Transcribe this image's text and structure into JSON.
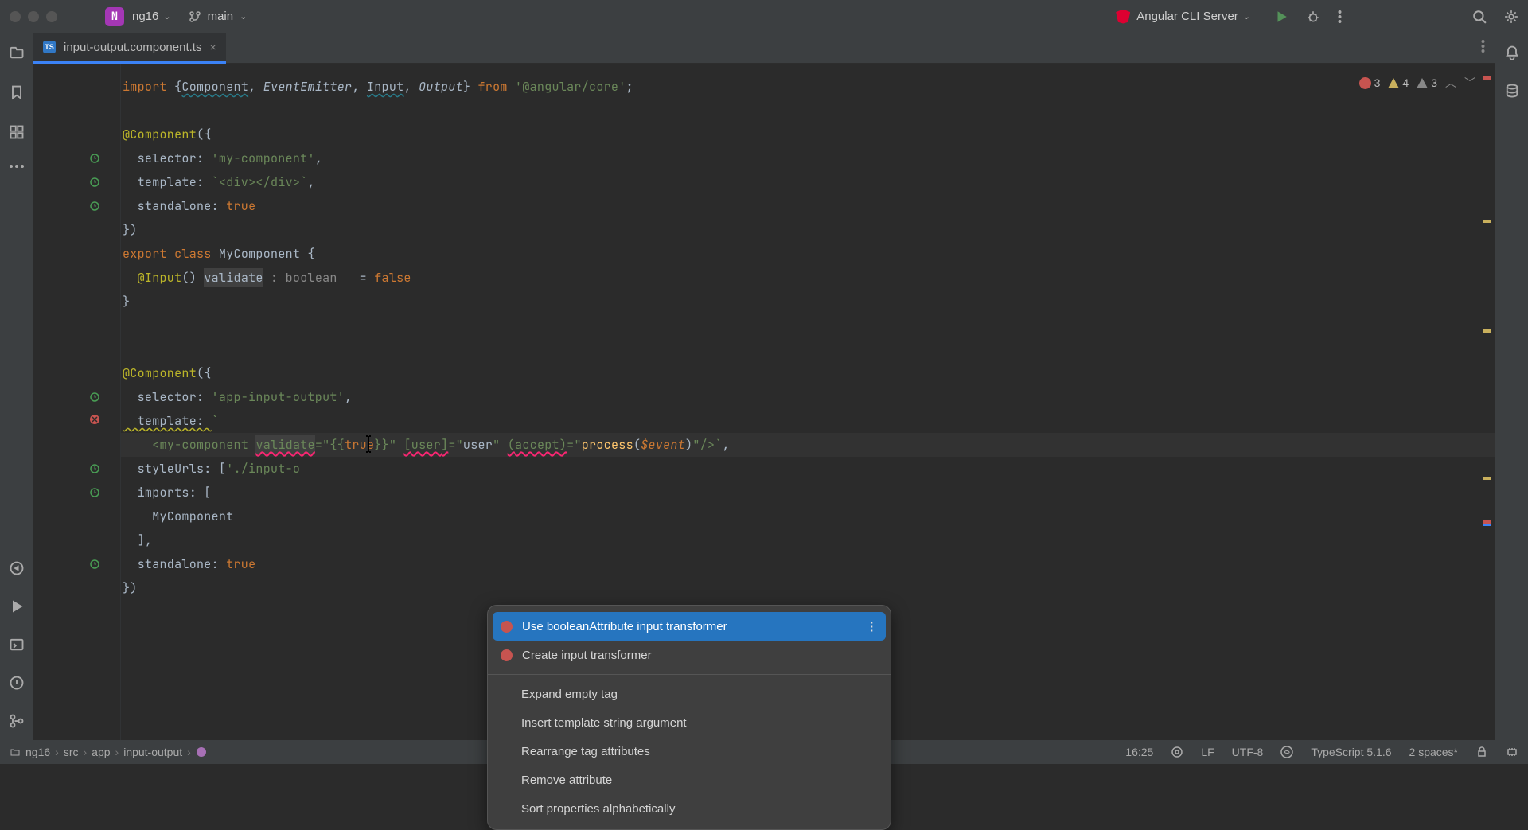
{
  "topbar": {
    "project_name": "ng16",
    "branch": "main",
    "server": "Angular CLI Server"
  },
  "tab": {
    "filename": "input-output.component.ts",
    "file_type": "TS"
  },
  "inspection": {
    "errors": "3",
    "warnings": "4",
    "weak": "3"
  },
  "code": {
    "l1_import": "import",
    "l1_braceopen": " {",
    "l1_component": "Component",
    "l1_c1": ", ",
    "l1_eventemitter": "EventEmitter",
    "l1_c2": ", ",
    "l1_input": "Input",
    "l1_c3": ", ",
    "l1_output": "Output",
    "l1_braceclose": "} ",
    "l1_from": "from ",
    "l1_path": "'@angular/core'",
    "l1_semi": ";",
    "l3_dec": "@Component",
    "l3_rest": "({",
    "l4_key": "  selector: ",
    "l4_val": "'my-component'",
    "l4_c": ",",
    "l5_key": "  template: ",
    "l5_val": "`<div></div>`",
    "l5_c": ",",
    "l6_key": "  standalone: ",
    "l6_val": "true",
    "l7": "})",
    "l8_export": "export ",
    "l8_class": "class ",
    "l8_name": "MyComponent ",
    "l8_brace": "{",
    "l9_dec": "  @Input",
    "l9_paren": "() ",
    "l9_name": "validate",
    "l9_typeinf": " : boolean  ",
    "l9_eq": " = ",
    "l9_val": "false",
    "l10": "}",
    "l13_dec": "@Component",
    "l13_rest": "({",
    "l14_key": "  selector: ",
    "l14_val": "'app-input-output'",
    "l14_c": ",",
    "l15_key": "  template: ",
    "l15_tick": "`",
    "l16_pre": "    <",
    "l16_tag": "my-component",
    "l16_sp1": " ",
    "l16_attr1": "validate",
    "l16_eq1": "=\"",
    "l16_bind1": "{{",
    "l16_true": "true",
    "l16_bind1c": "}}",
    "l16_q1": "\" ",
    "l16_user_open": "[",
    "l16_user": "user",
    "l16_user_close": "]",
    "l16_eq2": "=\"",
    "l16_userval": "user",
    "l16_q2": "\" ",
    "l16_accept_open": "(",
    "l16_accept": "accept",
    "l16_accept_close": ")",
    "l16_eq3": "=\"",
    "l16_process": "process",
    "l16_p1": "(",
    "l16_event": "$event",
    "l16_p2": ")",
    "l16_q3": "\"/>`",
    "l16_c": ",",
    "l17_key": "  styleUrls: [",
    "l17_val": "'./input-o",
    "l18_key": "  imports: [",
    "l19": "    MyComponent",
    "l20": "  ],",
    "l21_key": "  standalone: ",
    "l21_val": "true",
    "l22": "})"
  },
  "menu": {
    "item1": "Use booleanAttribute input transformer",
    "item2": "Create input transformer",
    "item3": "Expand empty tag",
    "item4": "Insert template string argument",
    "item5": "Rearrange tag attributes",
    "item6": "Remove attribute",
    "item7": "Sort properties alphabetically"
  },
  "breadcrumb": {
    "c1": "ng16",
    "c2": "src",
    "c3": "app",
    "c4": "input-output"
  },
  "status": {
    "time": "16:25",
    "line_ending": "LF",
    "encoding": "UTF-8",
    "lang": "TypeScript 5.1.6",
    "indent": "2 spaces*"
  }
}
